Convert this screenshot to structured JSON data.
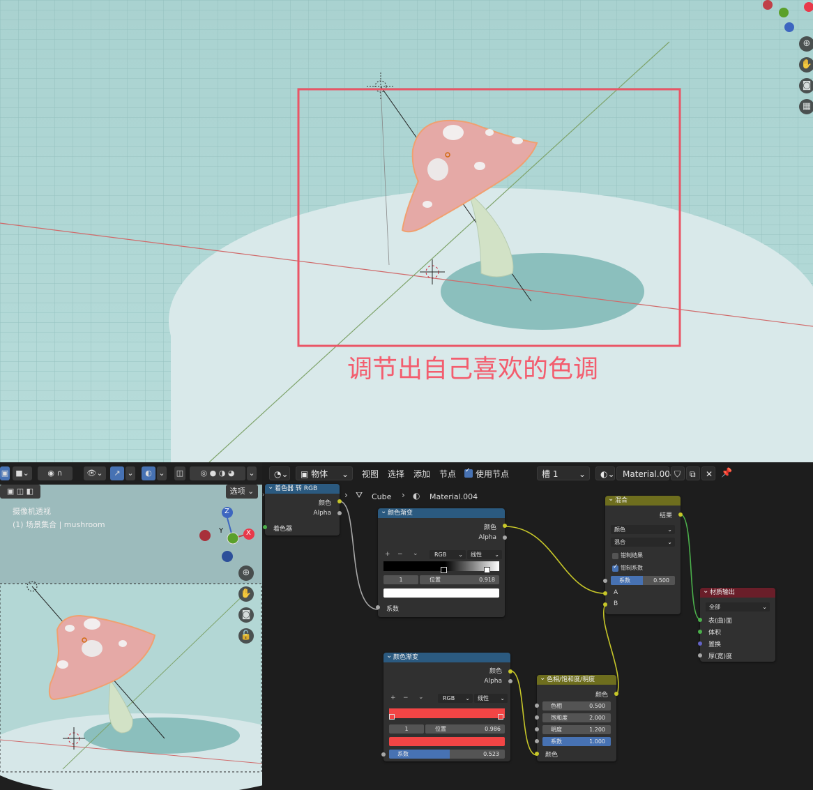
{
  "annotation": {
    "text": "调节出自己喜欢的色调",
    "color": "#f35d6e"
  },
  "gizmo": {
    "z": "Z",
    "y": "Y",
    "x": "X"
  },
  "small_view": {
    "options_label": "选项",
    "title": "摄像机透视",
    "subtitle": "(1) 场景集合 | mushroom"
  },
  "node_editor": {
    "mode": "物体",
    "menus": [
      "视图",
      "选择",
      "添加",
      "节点"
    ],
    "use_nodes_label": "使用节点",
    "slot": "槽 1",
    "material_name": "Material.004",
    "breadcrumb": {
      "object": "mushroom",
      "mesh": "Cube",
      "material": "Material.004"
    }
  },
  "nodes": {
    "shader_to_rgb": {
      "title": "着色器 转 RGB",
      "out_color": "颜色",
      "out_alpha": "Alpha",
      "in_shader": "着色器"
    },
    "ramp1": {
      "title": "颜色渐变",
      "out_color": "颜色",
      "out_alpha": "Alpha",
      "plus": "+",
      "minus": "−",
      "mode": "RGB",
      "interp": "线性",
      "stop_index": "1",
      "pos_label": "位置",
      "pos_value": "0.918",
      "in_fac": "系数",
      "color_stop": "#ffffff"
    },
    "ramp2": {
      "title": "颜色渐变",
      "out_color": "颜色",
      "out_alpha": "Alpha",
      "plus": "+",
      "minus": "−",
      "mode": "RGB",
      "interp": "线性",
      "stop_index": "1",
      "pos_label": "位置",
      "pos_value": "0.986",
      "fac_label": "系数",
      "fac_value": "0.523",
      "fac_fraction": 0.523,
      "color_stop": "#f24545"
    },
    "mix": {
      "title": "混合",
      "out_result": "结果",
      "data_type": "颜色",
      "blend": "混合",
      "clamp_result": "钳制结果",
      "clamp_factor": "钳制系数",
      "fac_label": "系数",
      "fac_value": "0.500",
      "fac_fraction": 0.5,
      "in_a": "A",
      "in_b": "B"
    },
    "hsv": {
      "title": "色相/饱和度/明度",
      "out_color": "颜色",
      "hue_label": "色相",
      "hue_value": "0.500",
      "sat_label": "饱和度",
      "sat_value": "2.000",
      "val_label": "明度",
      "val_value": "1.200",
      "fac_label": "系数",
      "fac_value": "1.000",
      "in_color": "颜色"
    },
    "output": {
      "title": "材质输出",
      "target": "全部",
      "in_surface": "表(曲)面",
      "in_volume": "体积",
      "in_displacement": "置换",
      "in_thickness": "厚(宽)度"
    }
  },
  "colors": {
    "shader_header": "#2b5a80",
    "converter_header": "#2b5a80",
    "color_header": "#6e6e1e",
    "output_header": "#6a1e29",
    "link": "#c7c729",
    "shader_link": "#4bb04b"
  }
}
